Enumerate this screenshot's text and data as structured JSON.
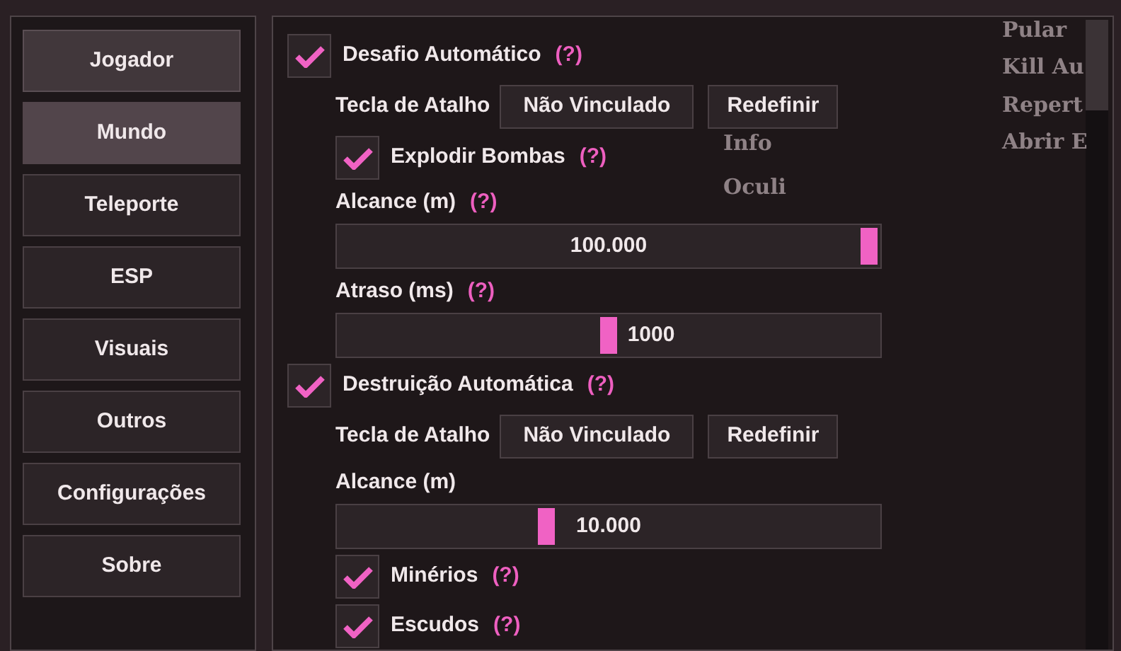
{
  "background_text": [
    {
      "text": "Pular"
    },
    {
      "text": "Kill Au"
    },
    {
      "text": "Repert"
    },
    {
      "text": "Info"
    },
    {
      "text": "Abrir E"
    },
    {
      "text": "Oculi"
    }
  ],
  "sidebar": {
    "items": [
      {
        "label": "Jogador",
        "selected": false,
        "hovered": true
      },
      {
        "label": "Mundo",
        "selected": true,
        "hovered": false
      },
      {
        "label": "Teleporte",
        "selected": false,
        "hovered": false
      },
      {
        "label": "ESP",
        "selected": false,
        "hovered": false
      },
      {
        "label": "Visuais",
        "selected": false,
        "hovered": false
      },
      {
        "label": "Outros",
        "selected": false,
        "hovered": false
      },
      {
        "label": "Configurações",
        "selected": false,
        "hovered": false
      },
      {
        "label": "Sobre",
        "selected": false,
        "hovered": false
      }
    ]
  },
  "options": [
    {
      "kind": "checkbox",
      "label": "Desafio Automático",
      "checked": true,
      "help": "(?)",
      "children": [
        {
          "kind": "hotkey",
          "label": "Tecla de Atalho",
          "value": "Não Vinculado",
          "reset": "Redefinir"
        },
        {
          "kind": "checkbox",
          "label": "Explodir Bombas",
          "checked": true,
          "help": "(?)"
        },
        {
          "kind": "slider",
          "label": "Alcance (m)",
          "help": "(?)",
          "value": "100.000",
          "level": 1
        },
        {
          "kind": "slider",
          "label": "Atraso (ms)",
          "help": "(?)",
          "value": "1000",
          "level": 0.5
        }
      ]
    },
    {
      "kind": "checkbox",
      "label": "Destruição Automática",
      "checked": true,
      "help": "(?)",
      "children": [
        {
          "kind": "hotkey",
          "label": "Tecla de Atalho",
          "value": "Não Vinculado",
          "reset": "Redefinir"
        },
        {
          "kind": "slider",
          "label": "Alcance (m)",
          "value": "10.000",
          "level": 0.38
        },
        {
          "kind": "checkbox",
          "label": "Minérios",
          "checked": true,
          "help": "(?)"
        },
        {
          "kind": "checkbox",
          "label": "Escudos",
          "checked": true,
          "help": "(?)"
        }
      ]
    }
  ]
}
